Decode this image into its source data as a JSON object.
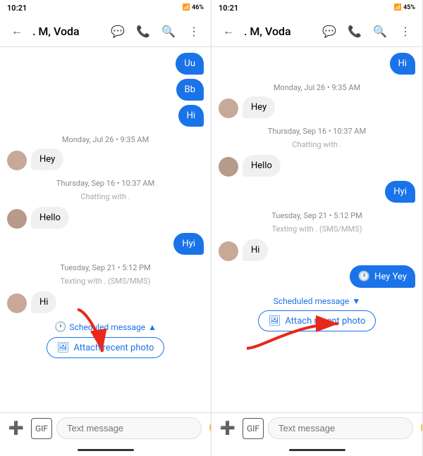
{
  "panel_left": {
    "status_bar": {
      "time": "10:21",
      "battery": "46%"
    },
    "app_bar": {
      "back": "←",
      "contact": ". M, Voda",
      "icons": [
        "message-icon",
        "phone-icon",
        "search-icon",
        "more-icon"
      ]
    },
    "messages": [
      {
        "type": "sent_bubble",
        "text": "Uu",
        "color": "#1a73e8"
      },
      {
        "type": "sent_bubble",
        "text": "Bb",
        "color": "#1a73e8"
      },
      {
        "type": "sent_bubble",
        "text": "Hi",
        "color": "#1a73e8"
      },
      {
        "type": "date",
        "text": "Monday, Jul 26 • 9:35 AM"
      },
      {
        "type": "received",
        "text": "Hey"
      },
      {
        "type": "date",
        "text": "Thursday, Sep 16 • 10:37 AM"
      },
      {
        "type": "sub",
        "text": "Chatting with ."
      },
      {
        "type": "received",
        "text": "Hello"
      },
      {
        "type": "sent_bubble_mid",
        "text": "Hyi",
        "color": "#1a73e8"
      },
      {
        "type": "date",
        "text": "Tuesday, Sep 21 • 5:12 PM"
      },
      {
        "type": "sub",
        "text": "Texting with . (SMS/MMS)"
      },
      {
        "type": "received",
        "text": "Hi"
      }
    ],
    "scheduled": {
      "label": "Scheduled message",
      "arrow": "▲"
    },
    "attach_btn": "Attach recent photo",
    "input_placeholder": "Text message",
    "bottom_icons": [
      "add-icon",
      "gif-icon",
      "emoji-icon",
      "mic-icon"
    ]
  },
  "panel_right": {
    "status_bar": {
      "time": "10:21",
      "battery": "45%"
    },
    "app_bar": {
      "back": "←",
      "contact": ". M, Voda",
      "icons": [
        "message-icon",
        "phone-icon",
        "search-icon",
        "more-icon"
      ]
    },
    "messages": [
      {
        "type": "sent_bubble",
        "text": "Hi",
        "color": "#1a73e8"
      },
      {
        "type": "date",
        "text": "Monday, Jul 26 • 9:35 AM"
      },
      {
        "type": "received",
        "text": "Hey"
      },
      {
        "type": "date",
        "text": "Thursday, Sep 16 • 10:37 AM"
      },
      {
        "type": "sub",
        "text": "Chatting with ."
      },
      {
        "type": "received",
        "text": "Hello"
      },
      {
        "type": "sent_scheduled",
        "text": "Hyi",
        "color": "#1a73e8"
      },
      {
        "type": "date",
        "text": "Tuesday, Sep 21 • 5:12 PM"
      },
      {
        "type": "sub",
        "text": "Texting with . (SMS/MMS)"
      },
      {
        "type": "received",
        "text": "Hi"
      },
      {
        "type": "sent_scheduled_bubble",
        "text": "Hey Yey"
      }
    ],
    "scheduled": {
      "label": "Scheduled message",
      "arrow": "▼"
    },
    "attach_btn": "Attach recent photo",
    "input_placeholder": "Text message",
    "bottom_icons": [
      "add-icon",
      "gif-icon",
      "emoji-icon",
      "mic-icon"
    ]
  },
  "arrows": {
    "left_arrow_color": "#e8281a",
    "right_arrow_color": "#e8281a"
  }
}
